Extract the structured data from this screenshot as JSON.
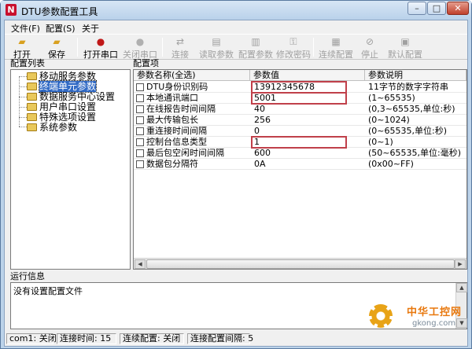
{
  "window": {
    "title": "DTU参数配置工具",
    "app_icon": "N"
  },
  "menu": [
    "文件(F)",
    "配置(S)",
    "关于"
  ],
  "toolbar": [
    {
      "label": "打开",
      "icon": "folder-open-icon",
      "enabled": true
    },
    {
      "label": "保存",
      "icon": "folder-save-icon",
      "enabled": true
    },
    {
      "label": "打开串口",
      "icon": "red-record-icon",
      "enabled": true
    },
    {
      "label": "关闭串口",
      "icon": "gray-record-icon",
      "enabled": false
    },
    {
      "label": "连接",
      "icon": "connect-icon",
      "enabled": false
    },
    {
      "label": "读取参数",
      "icon": "read-icon",
      "enabled": false
    },
    {
      "label": "配置参数",
      "icon": "config-icon",
      "enabled": false
    },
    {
      "label": "修改密码",
      "icon": "key-icon",
      "enabled": false
    },
    {
      "label": "连续配置",
      "icon": "continuous-icon",
      "enabled": false
    },
    {
      "label": "停止",
      "icon": "stop-icon",
      "enabled": false
    },
    {
      "label": "默认配置",
      "icon": "default-icon",
      "enabled": false
    }
  ],
  "tree": {
    "title": "配置列表",
    "items": [
      "移动服务参数",
      "终端单元参数",
      "数据服务中心设置",
      "用户串口设置",
      "特殊选项设置",
      "系统参数"
    ],
    "selected": 1
  },
  "params": {
    "title": "配置项",
    "headers": [
      "参数名称(全选)",
      "参数值",
      "参数说明"
    ],
    "rows": [
      {
        "name": "DTU身份识别码",
        "value": "13912345678",
        "desc": "11字节的数字字符串"
      },
      {
        "name": "本地通讯端口",
        "value": "5001",
        "desc": "(1~65535)"
      },
      {
        "name": "在线报告时间间隔",
        "value": "40",
        "desc": "(0,3~65535,单位:秒)"
      },
      {
        "name": "最大传输包长",
        "value": "256",
        "desc": "(0~1024)"
      },
      {
        "name": "重连接时间间隔",
        "value": "0",
        "desc": "(0~65535,单位:秒)"
      },
      {
        "name": "控制台信息类型",
        "value": "1",
        "desc": "(0~1)"
      },
      {
        "name": "最后包空闲时间间隔",
        "value": "600",
        "desc": "(50~65535,单位:毫秒)"
      },
      {
        "name": "数据包分隔符",
        "value": "0A",
        "desc": "(0x00~FF)"
      }
    ]
  },
  "log": {
    "title": "运行信息",
    "text": "没有设置配置文件"
  },
  "status": [
    "com1: 关闭",
    "连接时间: 15",
    "连续配置: 关闭",
    "连接配置间隔: 5"
  ],
  "watermark": {
    "title": "中华工控网",
    "url": "gkong.com"
  }
}
